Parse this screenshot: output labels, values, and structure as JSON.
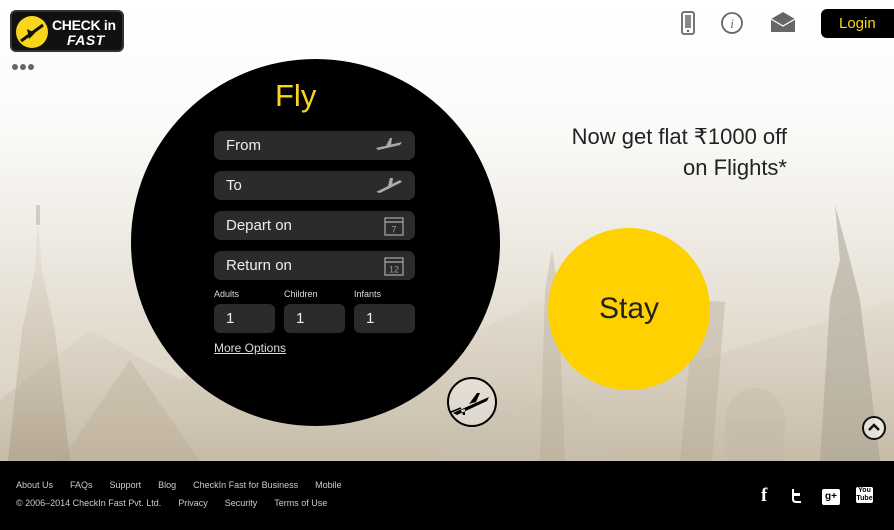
{
  "header": {
    "logo": {
      "line1": "CHECK in",
      "line2": "FAST"
    },
    "icons": [
      "mobile-phone-icon",
      "info-icon",
      "envelope-icon"
    ],
    "login_label": "Login"
  },
  "fly_form": {
    "title": "Fly",
    "from_placeholder": "From",
    "to_placeholder": "To",
    "depart_placeholder": "Depart on",
    "depart_icon_day": "7",
    "return_placeholder": "Return on",
    "return_icon_day": "12",
    "adults_label": "Adults",
    "children_label": "Children",
    "infants_label": "Infants",
    "adults_value": "1",
    "children_value": "1",
    "infants_value": "1",
    "more_options": "More Options"
  },
  "promo": {
    "line1": "Now get flat ₹1000 off",
    "line2": "on Flights*"
  },
  "stay_label": "Stay",
  "footer": {
    "links": [
      "About Us",
      "FAQs",
      "Support",
      "Blog",
      "CheckIn Fast for Business",
      "Mobile"
    ],
    "copyright": "© 2006–2014 CheckIn Fast Pvt. Ltd.",
    "legal_links": [
      "Privacy",
      "Security",
      "Terms of Use"
    ],
    "social": [
      "facebook-icon",
      "twitter-icon",
      "google-plus-icon",
      "youtube-icon"
    ],
    "gplus_text": "g+",
    "youtube_text": "You Tube"
  },
  "colors": {
    "brand_yellow": "#ffd100",
    "title_yellow": "#f9d51c",
    "dark": "#000000",
    "field_bg": "#2b2b2b"
  }
}
